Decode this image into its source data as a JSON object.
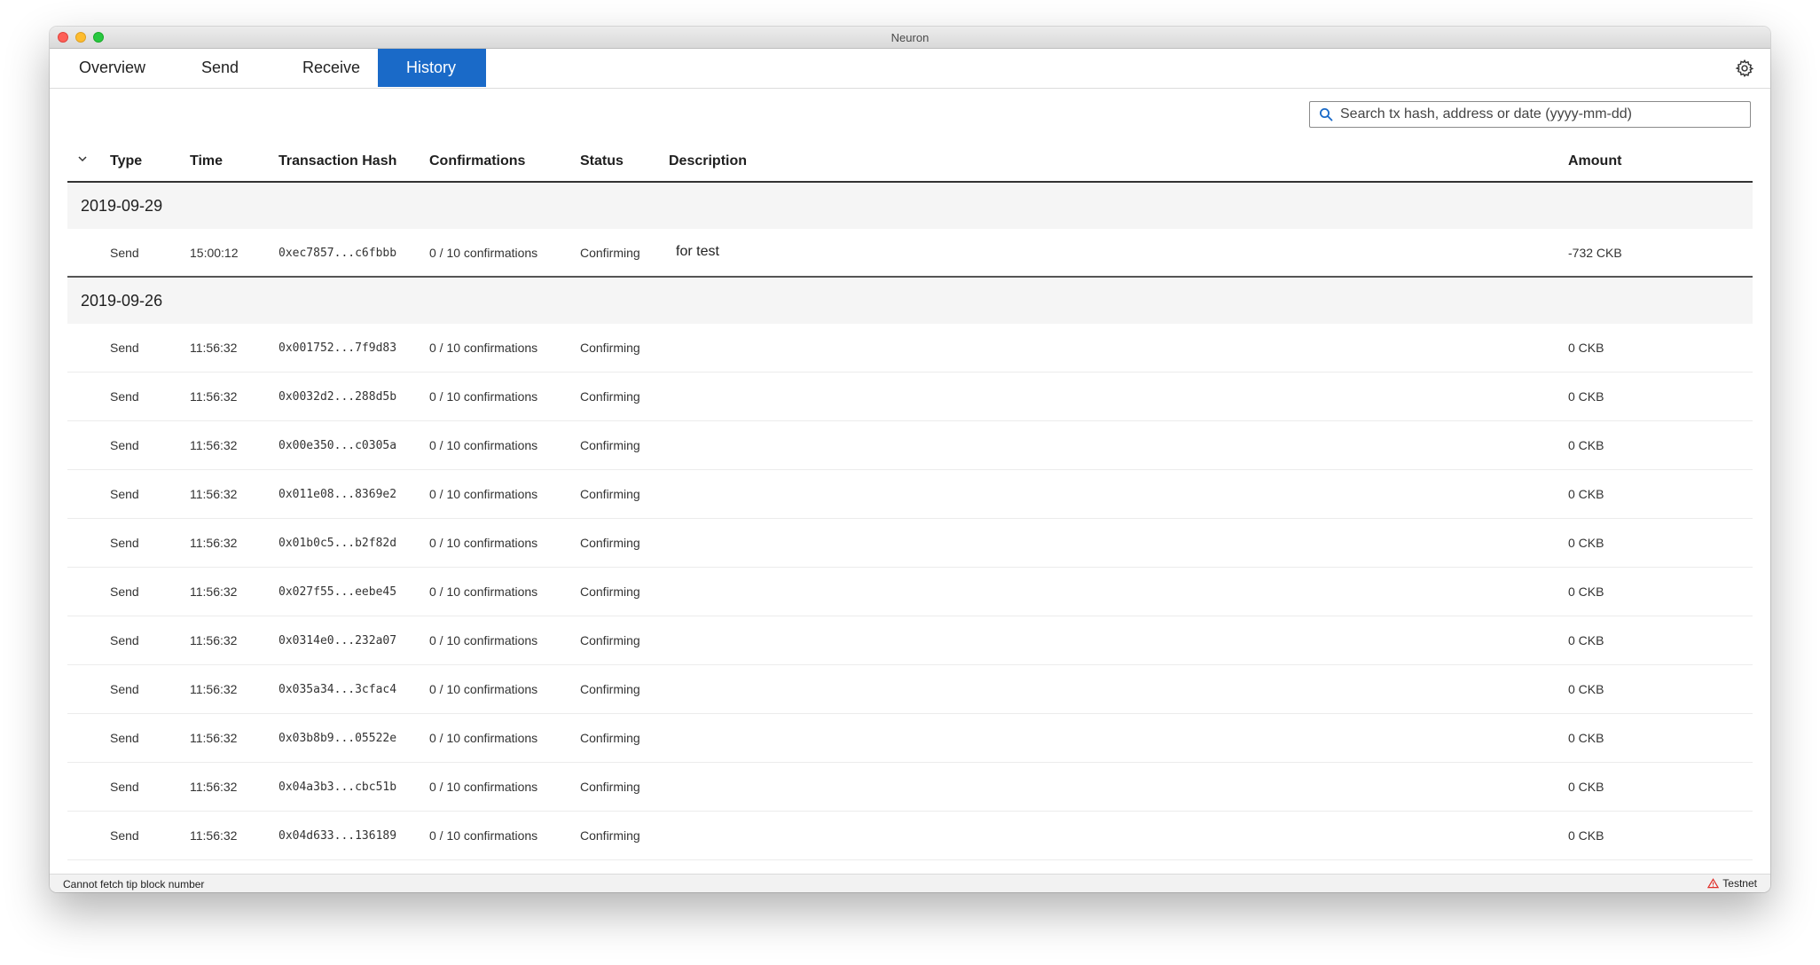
{
  "window": {
    "title": "Neuron"
  },
  "nav": {
    "tabs": [
      {
        "label": "Overview"
      },
      {
        "label": "Send"
      },
      {
        "label": "Receive"
      },
      {
        "label": "History"
      }
    ],
    "active_tab": "History"
  },
  "search": {
    "placeholder": "Search tx hash, address or date (yyyy-mm-dd)",
    "value": ""
  },
  "table": {
    "columns": {
      "type": "Type",
      "time": "Time",
      "hash": "Transaction Hash",
      "confirmations": "Confirmations",
      "status": "Status",
      "description": "Description",
      "amount": "Amount"
    },
    "groups": [
      {
        "date": "2019-09-29",
        "rows": [
          {
            "type": "Send",
            "time": "15:00:12",
            "hash": "0xec7857...c6fbbb",
            "confirmations": "0 / 10 confirmations",
            "status": "Confirming",
            "description": "for test",
            "amount": "-732 CKB"
          }
        ]
      },
      {
        "date": "2019-09-26",
        "rows": [
          {
            "type": "Send",
            "time": "11:56:32",
            "hash": "0x001752...7f9d83",
            "confirmations": "0 / 10 confirmations",
            "status": "Confirming",
            "description": "",
            "amount": "0 CKB"
          },
          {
            "type": "Send",
            "time": "11:56:32",
            "hash": "0x0032d2...288d5b",
            "confirmations": "0 / 10 confirmations",
            "status": "Confirming",
            "description": "",
            "amount": "0 CKB"
          },
          {
            "type": "Send",
            "time": "11:56:32",
            "hash": "0x00e350...c0305a",
            "confirmations": "0 / 10 confirmations",
            "status": "Confirming",
            "description": "",
            "amount": "0 CKB"
          },
          {
            "type": "Send",
            "time": "11:56:32",
            "hash": "0x011e08...8369e2",
            "confirmations": "0 / 10 confirmations",
            "status": "Confirming",
            "description": "",
            "amount": "0 CKB"
          },
          {
            "type": "Send",
            "time": "11:56:32",
            "hash": "0x01b0c5...b2f82d",
            "confirmations": "0 / 10 confirmations",
            "status": "Confirming",
            "description": "",
            "amount": "0 CKB"
          },
          {
            "type": "Send",
            "time": "11:56:32",
            "hash": "0x027f55...eebe45",
            "confirmations": "0 / 10 confirmations",
            "status": "Confirming",
            "description": "",
            "amount": "0 CKB"
          },
          {
            "type": "Send",
            "time": "11:56:32",
            "hash": "0x0314e0...232a07",
            "confirmations": "0 / 10 confirmations",
            "status": "Confirming",
            "description": "",
            "amount": "0 CKB"
          },
          {
            "type": "Send",
            "time": "11:56:32",
            "hash": "0x035a34...3cfac4",
            "confirmations": "0 / 10 confirmations",
            "status": "Confirming",
            "description": "",
            "amount": "0 CKB"
          },
          {
            "type": "Send",
            "time": "11:56:32",
            "hash": "0x03b8b9...05522e",
            "confirmations": "0 / 10 confirmations",
            "status": "Confirming",
            "description": "",
            "amount": "0 CKB"
          },
          {
            "type": "Send",
            "time": "11:56:32",
            "hash": "0x04a3b3...cbc51b",
            "confirmations": "0 / 10 confirmations",
            "status": "Confirming",
            "description": "",
            "amount": "0 CKB"
          },
          {
            "type": "Send",
            "time": "11:56:32",
            "hash": "0x04d633...136189",
            "confirmations": "0 / 10 confirmations",
            "status": "Confirming",
            "description": "",
            "amount": "0 CKB"
          }
        ]
      }
    ]
  },
  "footer": {
    "tip_status": "Cannot fetch tip block number",
    "network": "Testnet"
  },
  "colors": {
    "accent": "#1a6ac8",
    "warning": "#e0302b"
  },
  "icons": {
    "search": "search-icon",
    "settings": "gear-icon",
    "sort": "chevron-down-icon",
    "warning": "warning-icon"
  }
}
